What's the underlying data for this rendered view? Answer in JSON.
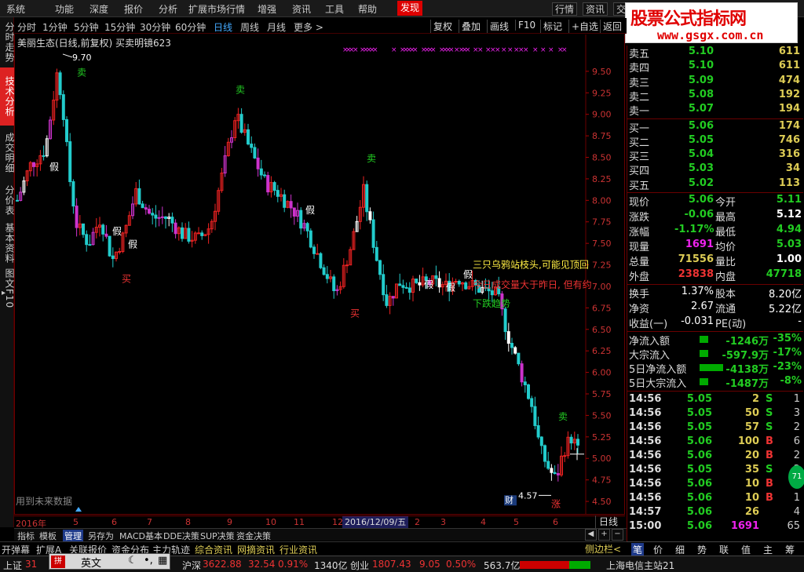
{
  "menu": [
    "系统",
    "功能",
    "深度",
    "报价",
    "分析",
    "扩展市场行情",
    "增强",
    "资讯",
    "工具",
    "帮助",
    "发现"
  ],
  "menu_active": "发现",
  "top_buttons": [
    "行情",
    "资讯",
    "交"
  ],
  "brand": {
    "main": "股票公式指标网",
    "url": "www.gsgx.com.cn"
  },
  "periods": [
    "分时",
    "1分钟",
    "5分钟",
    "15分钟",
    "30分钟",
    "60分钟",
    "日线",
    "周线",
    "月线",
    "更多 >"
  ],
  "period_active": "日线",
  "chart_toolbar": [
    "复权",
    "叠加",
    "画线",
    "F10",
    "标记",
    "+自选",
    "返回"
  ],
  "left_tabs": [
    "分时走势",
    "技术分析",
    "成交明细",
    "分价表",
    "基本资料",
    "图文F10"
  ],
  "left_tab_active": "技术分析",
  "chart_title": "美丽生态(日线,前复权) 买卖明镜623",
  "chart_note": "用到未来数据",
  "annotations": {
    "high_label": "9.70",
    "low_label": "4.57",
    "warn1": "三只乌鸦站枝头,可能见顶回",
    "warn2": "今日成交量大于昨日, 但有约",
    "trend": "下跌趋势",
    "sell": "卖",
    "buy": "买",
    "fake": "假",
    "fin": "财",
    "up": "涨"
  },
  "x_axis": {
    "ticks": [
      "2016年",
      "5",
      "6",
      "7",
      "8",
      "9",
      "10",
      "11",
      "12",
      "2",
      "3",
      "4",
      "5",
      "6"
    ],
    "cursor_date": "2016/12/09/五",
    "period_label": "日线"
  },
  "chart_data": {
    "type": "candlestick",
    "ylim": [
      4.4,
      9.8
    ],
    "ticks": [
      "9.50",
      "9.25",
      "9.00",
      "8.75",
      "8.50",
      "8.25",
      "8.00",
      "7.75",
      "7.50",
      "7.25",
      "7.00",
      "6.75",
      "6.50",
      "6.25",
      "6.00",
      "5.75",
      "5.50",
      "5.25",
      "5.00",
      "4.75",
      "4.50"
    ],
    "high": 9.7,
    "low": 4.57,
    "last": 5.06
  },
  "tool_row": [
    "指标",
    "模板",
    "管理",
    "另存为",
    "MACD基本",
    "DDE决策",
    "SUP决策",
    "资金决策"
  ],
  "tool_row_active": "管理",
  "bottom_tabs": [
    "开弹幕",
    "扩展A",
    "关联报价",
    "资金分布",
    "主力轨迹",
    "综合资讯",
    "网摘资讯",
    "行业资讯"
  ],
  "sidebar_toggle": "侧边栏<",
  "right_panel": {
    "asks": [
      {
        "label": "卖五",
        "price": "5.10",
        "vol": "611"
      },
      {
        "label": "卖四",
        "price": "5.10",
        "vol": "611"
      },
      {
        "label": "卖三",
        "price": "5.09",
        "vol": "474"
      },
      {
        "label": "卖二",
        "price": "5.08",
        "vol": "192"
      },
      {
        "label": "卖一",
        "price": "5.07",
        "vol": "194"
      }
    ],
    "bids": [
      {
        "label": "买一",
        "price": "5.06",
        "vol": "174"
      },
      {
        "label": "买二",
        "price": "5.05",
        "vol": "746"
      },
      {
        "label": "买三",
        "price": "5.04",
        "vol": "316"
      },
      {
        "label": "买四",
        "price": "5.03",
        "vol": "34"
      },
      {
        "label": "买五",
        "price": "5.02",
        "vol": "113"
      }
    ],
    "quote": [
      {
        "l1": "现价",
        "v1": "5.06",
        "c1": "#22cc22",
        "l2": "今开",
        "v2": "5.11",
        "c2": "#22cc22"
      },
      {
        "l1": "涨跌",
        "v1": "-0.06",
        "c1": "#22cc22",
        "l2": "最高",
        "v2": "5.12",
        "c2": "#ffffff"
      },
      {
        "l1": "涨幅",
        "v1": "-1.17%",
        "c1": "#22cc22",
        "l2": "最低",
        "v2": "4.94",
        "c2": "#22cc22"
      },
      {
        "l1": "现量",
        "v1": "1691",
        "c1": "#ee22ee",
        "l2": "均价",
        "v2": "5.03",
        "c2": "#22cc22"
      },
      {
        "l1": "总量",
        "v1": "71556",
        "c1": "#ddcc55",
        "l2": "量比",
        "v2": "1.00",
        "c2": "#ffffff"
      },
      {
        "l1": "外盘",
        "v1": "23838",
        "c1": "#ee3333",
        "l2": "内盘",
        "v2": "47718",
        "c2": "#22cc22"
      }
    ],
    "fundamentals": [
      {
        "l1": "换手",
        "v1": "1.37%",
        "l2": "股本",
        "v2": "8.20亿"
      },
      {
        "l1": "净资",
        "v1": "2.67",
        "l2": "流通",
        "v2": "5.22亿"
      },
      {
        "l1": "收益(一)",
        "v1": "-0.031",
        "l2": "PE(动)",
        "v2": "-"
      }
    ],
    "flows": [
      {
        "label": "净流入额",
        "value": "-1246万",
        "pct": "-35%",
        "bar": 0.08
      },
      {
        "label": "大宗流入",
        "value": "-597.9万",
        "pct": "-17%",
        "bar": 0.08
      },
      {
        "label": "5日净流入额",
        "value": "-4138万",
        "pct": "-23%",
        "bar": 0.55
      },
      {
        "label": "5日大宗流入",
        "value": "-1487万",
        "pct": "-8%",
        "bar": 0.08
      }
    ],
    "ticks": [
      {
        "time": "14:56",
        "price": "5.05",
        "vol": "2",
        "bs": "S",
        "n": "1"
      },
      {
        "time": "14:56",
        "price": "5.05",
        "vol": "50",
        "bs": "S",
        "n": "3"
      },
      {
        "time": "14:56",
        "price": "5.05",
        "vol": "57",
        "bs": "S",
        "n": "2"
      },
      {
        "time": "14:56",
        "price": "5.06",
        "vol": "100",
        "bs": "B",
        "n": "6"
      },
      {
        "time": "14:56",
        "price": "5.06",
        "vol": "20",
        "bs": "B",
        "n": "2"
      },
      {
        "time": "14:56",
        "price": "5.05",
        "vol": "35",
        "bs": "S",
        "n": "2"
      },
      {
        "time": "14:56",
        "price": "5.06",
        "vol": "10",
        "bs": "B",
        "n": "1"
      },
      {
        "time": "14:56",
        "price": "5.06",
        "vol": "10",
        "bs": "B",
        "n": "1"
      },
      {
        "time": "14:57",
        "price": "5.06",
        "vol": "26",
        "bs": "",
        "n": "4"
      },
      {
        "time": "15:00",
        "price": "5.06",
        "vol": "1691",
        "bs": "",
        "n": "65"
      }
    ],
    "bottom_tabs": [
      "笔",
      "价",
      "细",
      "势",
      "联",
      "值",
      "主",
      "筹"
    ],
    "bottom_active": "笔",
    "scroll_badge": "71"
  },
  "status": {
    "sh_label": "上证",
    "sh_val": "31",
    "hs_label": "沪深",
    "hs_val": "3622.88",
    "hs_chg": "32.54",
    "hs_pct": "0.91%",
    "hs_amt": "1340亿",
    "cy_label": "创业",
    "cy_val": "1807.43",
    "cy_chg": "9.05",
    "cy_pct": "0.50%",
    "cy_amt": "563.7亿",
    "server": "上海电信主站21"
  },
  "ime": {
    "logo": "拼",
    "lang": "英文"
  }
}
